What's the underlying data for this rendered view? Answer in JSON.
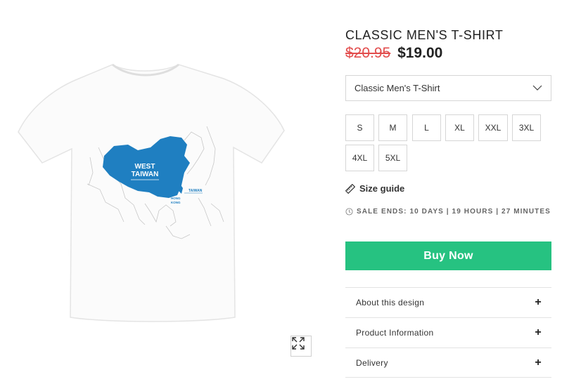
{
  "product": {
    "title": "CLASSIC MEN'S T-SHIRT",
    "old_price": "$20.95",
    "new_price": "$19.00",
    "price_old_color": "#e24d4d"
  },
  "shirt_print": {
    "region_label_line1": "WEST",
    "region_label_line2": "TAIWAN",
    "taiwan_label": "TAIWAN",
    "hk_label_line1": "HONG",
    "hk_label_line2": "KONG",
    "map_color": "#1f7fc1"
  },
  "style_select": {
    "selected": "Classic Men's T-Shirt",
    "icon": "chevron-down-icon"
  },
  "sizes": [
    "S",
    "M",
    "L",
    "XL",
    "XXL",
    "3XL",
    "4XL",
    "5XL"
  ],
  "size_guide": {
    "label": "Size guide",
    "icon": "ruler-icon"
  },
  "sale": {
    "text": "SALE ENDS: 10 DAYS | 19 HOURS | 27 MINUTES",
    "icon": "clock-icon"
  },
  "buy_button": {
    "label": "Buy Now",
    "color": "#26c281"
  },
  "accordion": [
    {
      "label": "About this design",
      "icon": "+"
    },
    {
      "label": "Product Information",
      "icon": "+"
    },
    {
      "label": "Delivery",
      "icon": "+"
    }
  ],
  "zoom": {
    "icon": "expand-icon"
  }
}
